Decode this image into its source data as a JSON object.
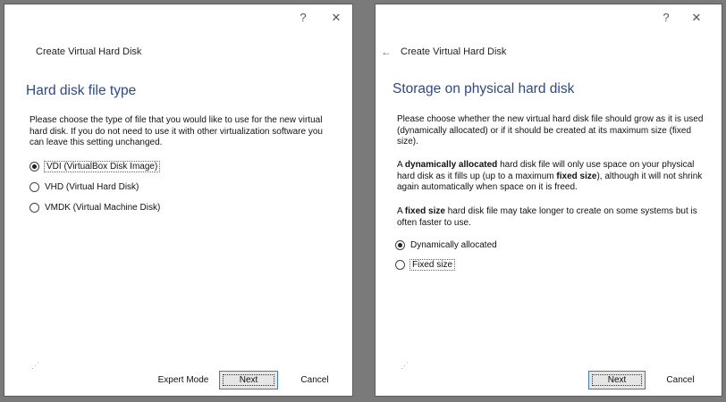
{
  "left": {
    "titlebar": {
      "help": "?",
      "close": "✕"
    },
    "wizard_title": "Create Virtual Hard Disk",
    "heading": "Hard disk file type",
    "description": "Please choose the type of file that you would like to use for the new virtual hard disk. If you do not need to use it with other virtualization software you can leave this setting unchanged.",
    "options": [
      {
        "label": "VDI (VirtualBox Disk Image)",
        "checked": true
      },
      {
        "label": "VHD (Virtual Hard Disk)",
        "checked": false
      },
      {
        "label": "VMDK (Virtual Machine Disk)",
        "checked": false
      }
    ],
    "buttons": {
      "expert": "Expert Mode",
      "next": "Next",
      "cancel": "Cancel"
    }
  },
  "right": {
    "titlebar": {
      "help": "?",
      "close": "✕"
    },
    "back_icon": "←",
    "wizard_title": "Create Virtual Hard Disk",
    "heading": "Storage on physical hard disk",
    "para1": "Please choose whether the new virtual hard disk file should grow as it is used (dynamically allocated) or if it should be created at its maximum size (fixed size).",
    "para2_a": "A ",
    "para2_b": "dynamically allocated",
    "para2_c": " hard disk file will only use space on your physical hard disk as it fills up (up to a maximum ",
    "para2_d": "fixed size",
    "para2_e": "), although it will not shrink again automatically when space on it is freed.",
    "para3_a": "A ",
    "para3_b": "fixed size",
    "para3_c": " hard disk file may take longer to create on some systems but is often faster to use.",
    "options": [
      {
        "label": "Dynamically allocated",
        "checked": true
      },
      {
        "label": "Fixed size",
        "checked": false
      }
    ],
    "buttons": {
      "next": "Next",
      "cancel": "Cancel"
    }
  }
}
